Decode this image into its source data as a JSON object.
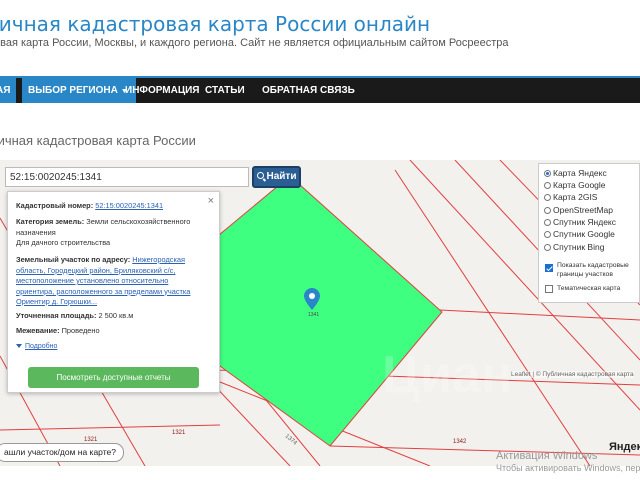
{
  "header": {
    "title": "личная кадастровая карта России онлайн",
    "subtitle": "овая карта России, Москвы, и каждого региона. Сайт не является официальным сайтом Росреестра"
  },
  "nav": {
    "items": [
      {
        "label": "АЯ"
      },
      {
        "label": "ВЫБОР РЕГИОНА"
      },
      {
        "label": "ИНФОРМАЦИЯ"
      },
      {
        "label": "СТАТЬИ"
      },
      {
        "label": "ОБРАТНАЯ СВЯЗЬ"
      }
    ]
  },
  "page": {
    "heading": "личная кадастровая карта России"
  },
  "search": {
    "value": "52:15:0020245:1341",
    "button_label": "Найти"
  },
  "info": {
    "cadastral_number_label": "Кадастровый номер:",
    "cadastral_number": "52:15:0020245:1341",
    "land_category_label": "Категория земель:",
    "land_category": "Земли сельскохозяйственного назначения",
    "use_type": "Для дачного строительства",
    "address_label": "Земельный участок по адресу:",
    "address": "Нижегородская область, Городецкий район, Бриляковский с/с, местоположение установлено относительно ориентира, расположенного за пределами участка Ориентир д. Горюшки...",
    "area_label": "Уточненная площадь:",
    "area": "2 500 кв.м",
    "survey_label": "Межевание:",
    "survey": "Проведено",
    "details_link": "Подробно",
    "reports_button": "Посмотреть доступные отчеты"
  },
  "layers": {
    "base_options": [
      {
        "label": "Карта Яндекс",
        "selected": true
      },
      {
        "label": "Карта Google",
        "selected": false
      },
      {
        "label": "Карта 2GIS",
        "selected": false
      },
      {
        "label": "OpenStreetMap",
        "selected": false
      },
      {
        "label": "Спутник Яндекс",
        "selected": false
      },
      {
        "label": "Спутник Google",
        "selected": false
      },
      {
        "label": "Спутник Bing",
        "selected": false
      }
    ],
    "show_borders_label": "Показать кадастровые границы участков",
    "show_borders_checked": true,
    "thematic_label": "Тематическая карта",
    "thematic_checked": false
  },
  "map": {
    "parcel_numbers": [
      "1321",
      "1321",
      "1374",
      "1342",
      "1341"
    ],
    "attribution": "Leaflet | © Публичная кадастровая карта",
    "yandex_logo": "Яндекс",
    "question": "ашли участок/дом на карте?",
    "watermark": "Циан"
  },
  "windows_activation": {
    "line1": "Активация Windows",
    "line2": "Чтобы активировать Windows, пере"
  },
  "colors": {
    "accent": "#2a87c7",
    "navbar_bg": "#1a1a1a",
    "parcel_fill": "#3fff80",
    "parcel_border": "#e04040",
    "reports_button": "#5cb85c",
    "search_button": "#2b5f93"
  },
  "icons": [
    "caret-down-icon",
    "search-icon",
    "close-icon",
    "map-pin-icon",
    "triangle-down-icon"
  ]
}
